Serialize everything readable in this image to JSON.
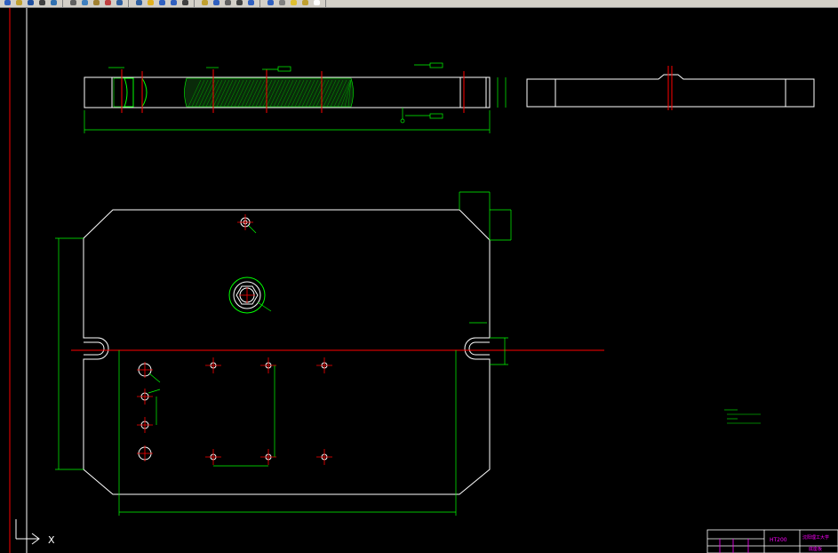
{
  "toolbar": {
    "buttons": [
      {
        "icon": "new-icon",
        "color": "#3060c0"
      },
      {
        "icon": "open-icon",
        "color": "#c0a030"
      },
      {
        "icon": "save-icon",
        "color": "#2050a0"
      },
      {
        "icon": "plot-icon",
        "color": "#404040"
      },
      {
        "icon": "preview-icon",
        "color": "#3070b0"
      },
      {
        "icon": "cut-icon",
        "color": "#606060"
      },
      {
        "icon": "copy-icon",
        "color": "#4080c0"
      },
      {
        "icon": "paste-icon",
        "color": "#a08030"
      },
      {
        "icon": "match-icon",
        "color": "#c04040"
      },
      {
        "icon": "undo-icon",
        "color": "#3060a0"
      },
      {
        "icon": "redo-icon",
        "color": "#3060a0"
      },
      {
        "icon": "pan-icon",
        "color": "#e0b020"
      },
      {
        "icon": "zoom-icon",
        "color": "#3060c0"
      },
      {
        "icon": "zoom-previous-icon",
        "color": "#3060c0"
      },
      {
        "icon": "properties-icon",
        "color": "#404040"
      },
      {
        "icon": "design-center-icon",
        "color": "#c0a030"
      },
      {
        "icon": "tool-palette-icon",
        "color": "#3060c0"
      },
      {
        "icon": "sheet-set-icon",
        "color": "#606060"
      },
      {
        "icon": "markup-icon",
        "color": "#404040"
      },
      {
        "icon": "calculator-icon",
        "color": "#3060c0"
      },
      {
        "icon": "help-icon",
        "color": "#3060c0"
      },
      {
        "icon": "layer-icon",
        "color": "#808080"
      },
      {
        "icon": "sun-icon",
        "color": "#e0c030"
      },
      {
        "icon": "lock-icon",
        "color": "#c0a030"
      },
      {
        "icon": "color-icon",
        "color": "#ffffff"
      }
    ]
  },
  "colors": {
    "outline": "#ffffff",
    "dimension": "#00ff00",
    "centerline": "#ff0000",
    "hatch": "#00ff00",
    "titleblock": "#ff00ff",
    "background": "#000000"
  },
  "drawing": {
    "title_block": {
      "material": "HT200",
      "school": "沈阳理工大学",
      "part_name": "底座板"
    },
    "ucs_label": "X"
  }
}
